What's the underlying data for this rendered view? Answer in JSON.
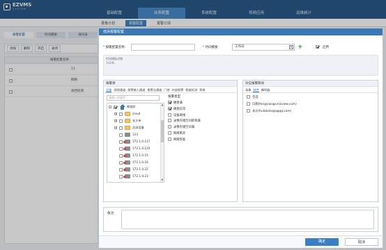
{
  "app": {
    "logo": "EZVMS",
    "logo_sub": "SYSTEM"
  },
  "main_nav": [
    "基础配置",
    "业务配置",
    "系统配置",
    "视频应用",
    "运维统计"
  ],
  "sub_nav": [
    "录像计划",
    "报警配置",
    "报警订阅"
  ],
  "bg": {
    "tabs": [
      "报警配置",
      "时间模板",
      "通讯录"
    ],
    "toolbar": [
      "添加",
      "删除",
      "开启",
      "关闭"
    ],
    "table_header": "报警配置名称",
    "rows": [
      "11",
      "网络",
      "遮挡检测"
    ]
  },
  "modal": {
    "title": "增添报警配置",
    "name_label": "报警配置名称:",
    "name_value": "",
    "template_label": "时间模板:",
    "template_value": "工作日",
    "enable_label": "启用",
    "detail_label": "时间模板详情",
    "detail_value": "7x24h",
    "source_title": "报警源",
    "source_tabs": [
      "设备",
      "视频通道",
      "报警输入通道",
      "报警点通道",
      "门禁",
      "外部报警",
      "智能检测",
      "系统"
    ],
    "search_placeholder": "请输入关键字",
    "tree": [
      {
        "label": "根组织",
        "kind": "home",
        "level": 0,
        "expander": "-",
        "checked": true
      },
      {
        "label": "cloud",
        "kind": "folder",
        "level": 1,
        "expander": "+",
        "checked": false
      },
      {
        "label": "长沙市",
        "kind": "folder",
        "level": 1,
        "expander": "+",
        "checked": false
      },
      {
        "label": "总部设备",
        "kind": "folder",
        "level": 1,
        "expander": "+",
        "checked": false
      },
      {
        "label": "123",
        "kind": "cam",
        "level": 1,
        "expander": "",
        "checked": false
      },
      {
        "label": "172.1.0.117",
        "kind": "cam-alarm",
        "level": 1,
        "expander": "",
        "checked": false
      },
      {
        "label": "172.1.0.120",
        "kind": "cam-alarm",
        "level": 1,
        "expander": "",
        "checked": false
      },
      {
        "label": "172.1.0.15",
        "kind": "cam-alarm",
        "level": 1,
        "expander": "",
        "checked": false
      },
      {
        "label": "172.1.0.16",
        "kind": "cam-alarm",
        "level": 1,
        "expander": "",
        "checked": false
      },
      {
        "label": "172.1.0.22",
        "kind": "cam-alarm",
        "level": 1,
        "expander": "",
        "checked": false
      },
      {
        "label": "172.1.0.23",
        "kind": "cam-alarm",
        "level": 1,
        "expander": "",
        "checked": false
      }
    ],
    "alarm_type_title": "报警类型",
    "alarm_types": [
      {
        "label": "硬盘满",
        "checked": true
      },
      {
        "label": "硬盘异常",
        "checked": true
      },
      {
        "label": "设备离线",
        "checked": false
      },
      {
        "label": "录像存储空间即将满",
        "checked": false
      },
      {
        "label": "录像存储空间满",
        "checked": false
      },
      {
        "label": "网络断开",
        "checked": false
      },
      {
        "label": "网络恢复",
        "checked": false
      }
    ],
    "link_title": "对应报警联动",
    "link_tabs": [
      "录像",
      "邮件",
      "蜂鸣器"
    ],
    "link_items": [
      {
        "label": "全选",
        "checked": false
      },
      {
        "label": "冯翔(fengxiao@unisview.com)",
        "checked": false
      },
      {
        "label": "长沙(hulabala@qqqq.com)",
        "checked": false
      }
    ],
    "remark_label": "备注:",
    "ok": "确定",
    "cancel": "取消"
  }
}
